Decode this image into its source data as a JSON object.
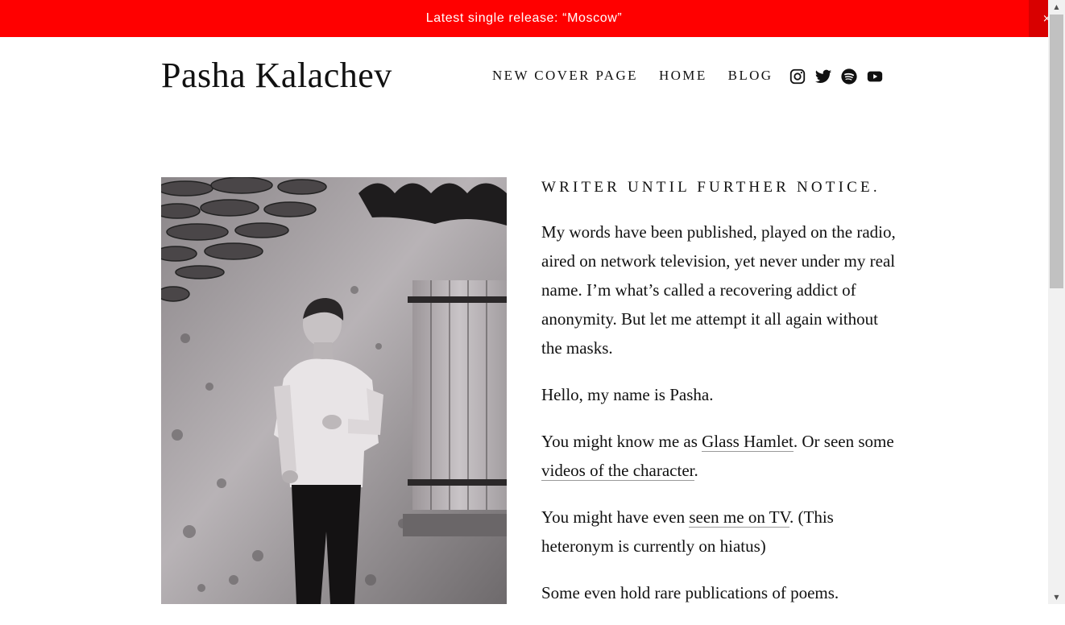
{
  "announcement": {
    "text": "Latest single release: “Moscow”",
    "close_label": "×"
  },
  "header": {
    "site_title": "Pasha Kalachev",
    "nav": [
      {
        "label": "NEW COVER PAGE"
      },
      {
        "label": "HOME"
      },
      {
        "label": "BLOG"
      }
    ],
    "social_icons": [
      "instagram-icon",
      "twitter-icon",
      "spotify-icon",
      "youtube-icon"
    ]
  },
  "colors": {
    "announcement_bg": "#ff0000",
    "text": "#111111",
    "link_underline": "#9a9a9a"
  },
  "main": {
    "tagline": "WRITER UNTIL FURTHER NOTICE.",
    "p1": "My words have been published, played on the radio, aired on network television, yet never under my real name. I’m what’s called a recovering addict of anonymity. But let me attempt it all again without the masks.",
    "p2": "Hello, my name is Pasha.",
    "p3": {
      "before": "You might know me as ",
      "link1": "Glass Hamlet",
      "middle": ". Or seen some ",
      "link2": "videos of the character",
      "after": "."
    },
    "p4": {
      "before": "You might have even ",
      "link": "seen me on TV",
      "after": ". (This heteronym is currently on hiatus)"
    },
    "p5": "Some even hold rare publications of poems."
  }
}
